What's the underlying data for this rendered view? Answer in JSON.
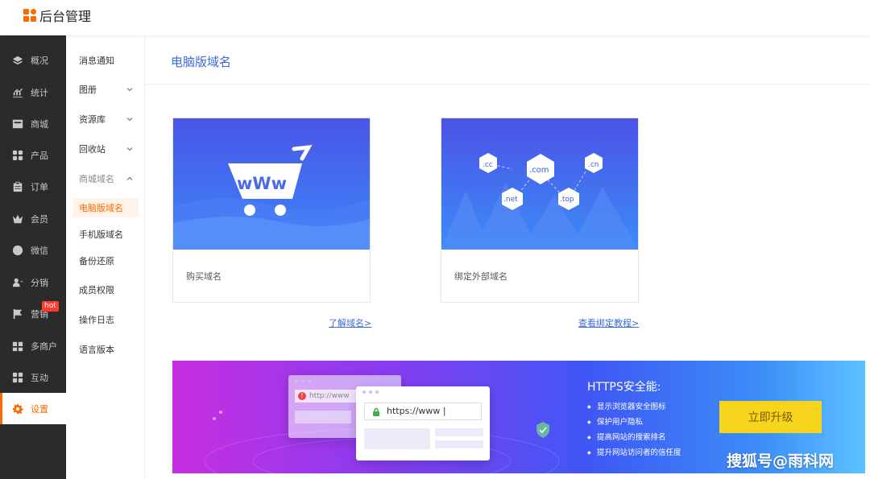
{
  "app": {
    "title": "后台管理"
  },
  "rail": {
    "items": [
      {
        "label": "概况",
        "icon": "layers-icon"
      },
      {
        "label": "统计",
        "icon": "chart-icon"
      },
      {
        "label": "商城",
        "icon": "store-icon"
      },
      {
        "label": "产品",
        "icon": "grid-icon"
      },
      {
        "label": "订单",
        "icon": "clipboard-icon"
      },
      {
        "label": "会员",
        "icon": "crown-icon"
      },
      {
        "label": "微信",
        "icon": "wechat-icon"
      },
      {
        "label": "分销",
        "icon": "user-share-icon"
      },
      {
        "label": "营销",
        "icon": "flag-icon",
        "badge": "hot"
      },
      {
        "label": "多商户",
        "icon": "merchant-icon"
      },
      {
        "label": "互动",
        "icon": "interact-icon"
      },
      {
        "label": "设置",
        "icon": "gear-icon",
        "active": true
      }
    ]
  },
  "subnav": {
    "items": [
      {
        "label": "消息通知"
      },
      {
        "label": "图册"
      },
      {
        "label": "资源库"
      },
      {
        "label": "回收站"
      },
      {
        "label": "商城域名"
      },
      {
        "label": "电脑版域名"
      },
      {
        "label": "手机版域名"
      },
      {
        "label": "备份还原"
      },
      {
        "label": "成员权限"
      },
      {
        "label": "操作日志"
      },
      {
        "label": "语言版本"
      }
    ]
  },
  "main": {
    "title": "电脑版域名",
    "cards": [
      {
        "label": "购买域名",
        "banner_text": "wWw"
      },
      {
        "label": "绑定外部域名",
        "domains": [
          ".cc",
          ".com",
          ".cn",
          ".net",
          ".top"
        ]
      }
    ],
    "links": {
      "learn": "了解域名>",
      "tutorial": "查看绑定教程>"
    },
    "promo": {
      "title": "HTTPS安全能:",
      "features": [
        "显示浏览器安全图标",
        "保护用户隐私",
        "提高网站的搜索排名",
        "提升网站访问者的信任度"
      ],
      "button": "立即升级",
      "old_url": "http://www",
      "new_url": "https://www |"
    },
    "watermark": "搜狐号@雨科网"
  },
  "colors": {
    "accent": "#ff6a00",
    "link": "#3a6ad8",
    "rail_bg": "#2b2b2b",
    "button": "#f7d51c"
  }
}
